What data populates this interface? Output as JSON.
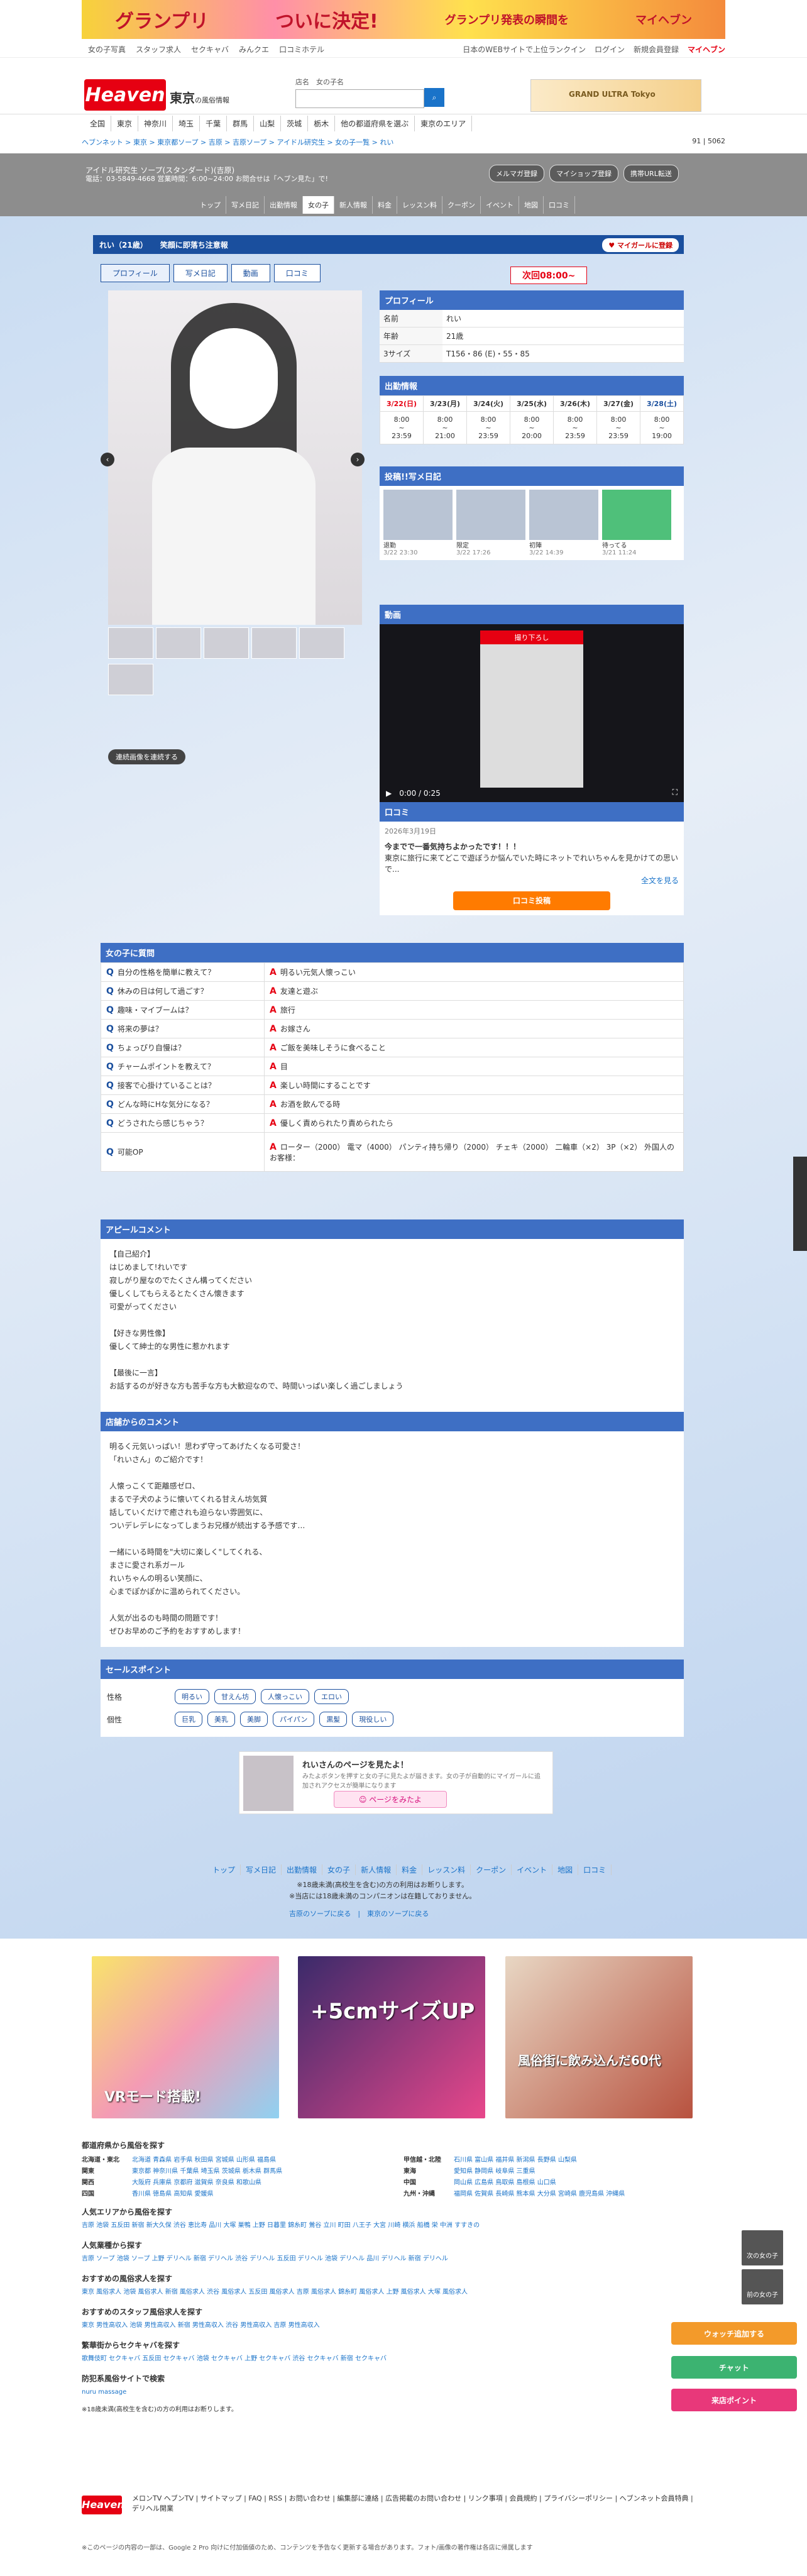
{
  "banner": {
    "text1": "グランプリ",
    "text2": "ついに決定!",
    "text3": "グランプリ発表の瞬間を",
    "text4": "マイヘブン"
  },
  "topnav": {
    "left": [
      "女の子写真",
      "スタッフ求人",
      "セクキャバ",
      "みんクエ",
      "口コミホテル"
    ],
    "right": [
      "日本のWEBサイトで上位ランクイン",
      "ログイン",
      "新規会員登録",
      "マイヘブン"
    ]
  },
  "header": {
    "logo": "Heaven",
    "area": "東京",
    "area_sub": "の風俗情報",
    "search_label": "店名",
    "search_label2": "女の子名"
  },
  "ad_right": "GRAND ULTRA Tokyo",
  "regions": [
    "全国",
    "東京",
    "神奈川",
    "埼玉",
    "千葉",
    "群馬",
    "山梨",
    "茨城",
    "栃木",
    "他の都道府県を選ぶ",
    "東京のエリア"
  ],
  "breadcrumb": "ヘブンネット > 東京 > 東京都ソープ > 吉原 > 吉原ソープ > アイドル研究生 > 女の子一覧 > れい",
  "counts": {
    "a": "91",
    "b": "5062"
  },
  "shop": {
    "name": "アイドル研究生 ソープ(スタンダード)(吉原)",
    "info": "電話：03-5849-4668 営業時間：6:00~24:00 お問合せは「ヘブン見た」で!",
    "buttons": [
      "メルマガ登録",
      "マイショップ登録",
      "携帯URL転送"
    ],
    "tabs": [
      "トップ",
      "写メ日記",
      "出勤情報",
      "女の子",
      "新人情報",
      "料金",
      "レッスン料",
      "クーポン",
      "イベント",
      "地図",
      "口コミ"
    ]
  },
  "girl": {
    "name": "れい（21歳）",
    "comment": "笑顔に即落ち注意報",
    "fav": "マイガールに登録",
    "subtabs": [
      "プロフィール",
      "写メ日記",
      "動画",
      "口コミ"
    ],
    "next": "次回08:00~"
  },
  "continuous": "連続画像を連続する",
  "profile": {
    "head": "プロフィール",
    "rows": [
      {
        "k": "名前",
        "v": "れい"
      },
      {
        "k": "年齢",
        "v": "21歳"
      },
      {
        "k": "3サイズ",
        "v": "T156・86 (E)・55・85"
      }
    ]
  },
  "schedule": {
    "head": "出勤情報",
    "days": [
      "3/22(日)",
      "3/23(月)",
      "3/24(火)",
      "3/25(水)",
      "3/26(木)",
      "3/27(金)",
      "3/28(土)"
    ],
    "start": [
      "8:00",
      "8:00",
      "8:00",
      "8:00",
      "8:00",
      "8:00",
      "8:00"
    ],
    "end": [
      "23:59",
      "21:00",
      "23:59",
      "20:00",
      "23:59",
      "23:59",
      "19:00"
    ]
  },
  "diary": {
    "head": "投稿!!写メ日記",
    "items": [
      {
        "t": "退勤",
        "d": "3/22 23:30"
      },
      {
        "t": "限定",
        "d": "3/22 17:26"
      },
      {
        "t": "初陣",
        "d": "3/22 14:39"
      },
      {
        "t": "待ってる",
        "d": "3/21 11:24"
      }
    ]
  },
  "video": {
    "head": "動画",
    "label": "撮り下ろし",
    "time": "0:00 / 0:25"
  },
  "kuchikomi": {
    "head": "口コミ",
    "date": "2026年3月19日",
    "title": "今までで一番気持ちよかったです！！！",
    "body": "東京に旅行に来てどこで遊ぼうか悩んでいた時にネットでれいちゃんを見かけての思いで...",
    "more": "全文を見る",
    "button": "口コミ投稿"
  },
  "qa": {
    "head": "女の子に質問",
    "rows": [
      {
        "q": "自分の性格を簡単に教えて？",
        "a": "明るい元気人懐っこい"
      },
      {
        "q": "休みの日は何して過ごす？",
        "a": "友達と遊ぶ"
      },
      {
        "q": "趣味・マイブームは？",
        "a": "旅行"
      },
      {
        "q": "将来の夢は？",
        "a": "お嫁さん"
      },
      {
        "q": "ちょっぴり自慢は？",
        "a": "ご飯を美味しそうに食べること"
      },
      {
        "q": "チャームポイントを教えて？",
        "a": "目"
      },
      {
        "q": "接客で心掛けていることは？",
        "a": "楽しい時間にすることです"
      },
      {
        "q": "どんな時にHな気分になる？",
        "a": "お酒を飲んでる時"
      },
      {
        "q": "どうされたら感じちゃう？",
        "a": "優しく責められたり責められたら"
      },
      {
        "q": "可能OP",
        "a": "ローター（2000） 電マ（4000） パンティ持ち帰り（2000） チェキ（2000） 二輪車（×2） 3P（×2） 外国人のお客様："
      }
    ]
  },
  "appeal": {
    "head": "アピールコメント",
    "body": "【自己紹介】\nはじめまして!れいです\n寂しがり屋なのでたくさん構ってください\n優しくしてもらえるとたくさん懐きます\n可愛がってください\n\n【好きな男性像】\n優しくて紳士的な男性に惹かれます\n\n【最後に一言】\nお話するのが好きな方も苦手な方も大歓迎なので、時間いっぱい楽しく過ごしましょう"
  },
  "shopcomment": {
    "head": "店舗からのコメント",
    "body": "明るく元気いっぱい！思わず守ってあげたくなる可愛さ！\n「れいさん」のご紹介です！\n\n人懐っこくて距離感ゼロ、\nまるで子犬のように懐いてくれる甘えん坊気質\n話していくだけで癒されも迫らない雰囲気に、\nついデレデレになってしまうお兄様が続出する予感です…\n\n一緒にいる時間を\"大切に楽しく\"してくれる、\nまさに愛され系ガール\nれいちゃんの明るい笑顔に、\n心までぽかぽかに温められてください。\n\n人気が出るのも時間の問題です！\nぜひお早めのご予約をおすすめします！"
  },
  "sales": {
    "head": "セールスポイント",
    "rows": [
      {
        "k": "性格",
        "tags": [
          "明るい",
          "甘えん坊",
          "人懐っこい",
          "エロい"
        ]
      },
      {
        "k": "個性",
        "tags": [
          "巨乳",
          "美乳",
          "美脚",
          "パイパン",
          "黒髪",
          "現役しい"
        ]
      }
    ]
  },
  "promo": {
    "title": "れいさんのページを見たよ！",
    "desc": "みたよボタンを押すと女の子に見たよが届きます。女の子が自動的にマイガールに追加されアクセスが簡単になります",
    "button": "ページをみたよ"
  },
  "bottomtabs": [
    "トップ",
    "写メ日記",
    "出勤情報",
    "女の子",
    "新人情報",
    "料金",
    "レッスン料",
    "クーポン",
    "イベント",
    "地図",
    "口コミ"
  ],
  "bottomnote": [
    "※18歳未満(高校生を含む)の方の利用はお断りします。",
    "※当店には18歳未満のコンパニオンは在籍しておりません。"
  ],
  "bottomlinks": [
    "吉原のソープに戻る",
    "東京のソープに戻る"
  ],
  "ads": [
    {
      "t": "VRモード搭載!"
    },
    {
      "t": "+5cmサイズUP"
    },
    {
      "t": "風俗街に飲み込んだ60代"
    }
  ],
  "footer": {
    "h1": "都道府県から風俗を探す",
    "regions": [
      {
        "h": "北海道・東北",
        "v": "北海道 青森県 岩手県 秋田県 宮城県 山形県 福島県"
      },
      {
        "h": "甲信越・北陸",
        "v": "石川県 富山県 福井県 新潟県 長野県 山梨県"
      },
      {
        "h": "関東",
        "v": "東京都 神奈川県 千葉県 埼玉県 茨城県 栃木県 群馬県"
      },
      {
        "h": "東海",
        "v": "愛知県 静岡県 岐阜県 三重県"
      },
      {
        "h": "関西",
        "v": "大阪府 兵庫県 京都府 滋賀県 奈良県 和歌山県"
      },
      {
        "h": "中国",
        "v": "岡山県 広島県 鳥取県 島根県 山口県"
      },
      {
        "h": "四国",
        "v": "香川県 徳島県 高知県 愛媛県"
      },
      {
        "h": "九州・沖縄",
        "v": "福岡県 佐賀県 長崎県 熊本県 大分県 宮崎県 鹿児島県 沖縄県"
      }
    ],
    "h2": "人気エリアから風俗を探す",
    "l2": "吉原 池袋 五反田 新宿 新大久保 渋谷 恵比寿 品川 大塚 巣鴨 上野 日暮里 錦糸町 鶯谷 立川 町田 八王子 大宮 川崎 横浜 船橋 栄 中洲 すすきの",
    "h3": "人気業種から探す",
    "l3": "吉原 ソープ 池袋 ソープ 上野 デリヘル 新宿 デリヘル 渋谷 デリヘル 五反田 デリヘル 池袋 デリヘル 品川 デリヘル 新宿 デリヘル",
    "h4": "おすすめの風俗求人を探す",
    "l4": "東京 風俗求人 池袋 風俗求人 新宿 風俗求人 渋谷 風俗求人 五反田 風俗求人 吉原 風俗求人 錦糸町 風俗求人 上野 風俗求人 大塚 風俗求人",
    "h5": "おすすめのスタッフ風俗求人を探す",
    "l5": "東京 男性高収入 池袋 男性高収入 新宿 男性高収入 渋谷 男性高収入 吉原 男性高収入",
    "h6": "繁華街からセクキャバを探す",
    "l6": "歌舞伎町 セクキャバ 五反田 セクキャバ 池袋 セクキャバ 上野 セクキャバ 渋谷 セクキャバ 新宿 セクキャバ",
    "h7": "防犯系風俗サイトで検索",
    "l7": "nuru massage",
    "note": "※18歳未満(高校生を含む)の方の利用はお断りします。"
  },
  "bottomfooter": {
    "logo": "Heaven",
    "links": "メロンTV ヘブンTV | サイトマップ | FAQ | RSS | お問い合わせ | 編集部に連絡 | 広告掲載のお問い合わせ | リンク事項 | 会員規約 | プライバシーポリシー | ヘブンネット会員特典 | デリヘル開業",
    "copy": "※このページの内容の一部は、Google 2 Pro 向けに付加価値のため、コンテンツを予告なく更新する場合があります。フォト/画像の著作権は各店に帰属します"
  },
  "floats": [
    {
      "t": "ウォッチ追加する",
      "c": "#f39a2a"
    },
    {
      "t": "チャット",
      "c": "#3cb371"
    },
    {
      "t": "来店ポイント",
      "c": "#e8387a"
    }
  ],
  "navbtns": [
    "次の女の子",
    "前の女の子"
  ]
}
